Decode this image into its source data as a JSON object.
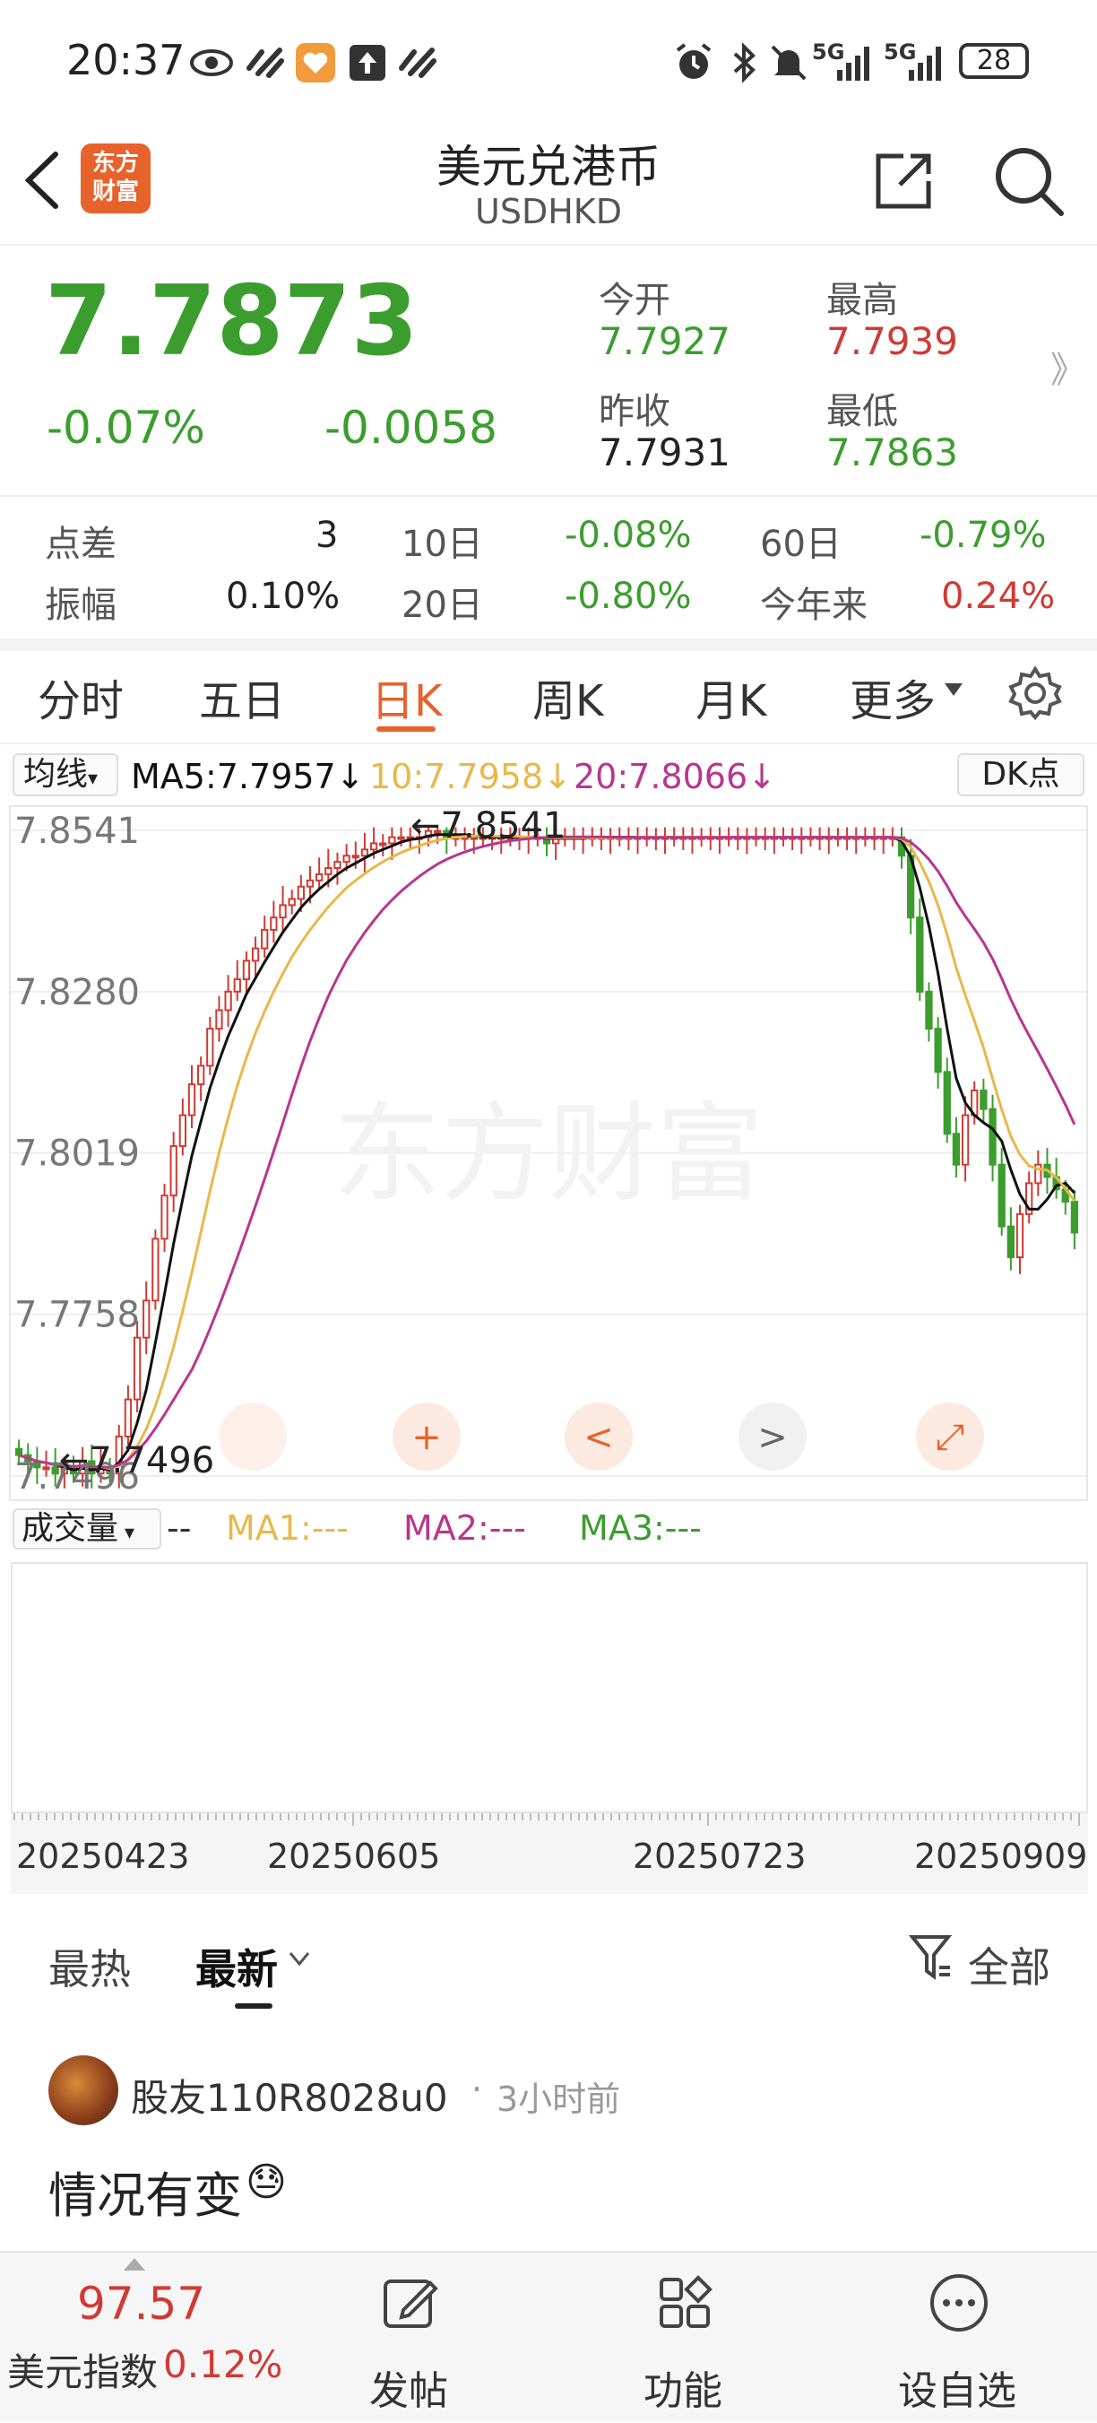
{
  "status_bar": {
    "time": "20:37",
    "battery": "28",
    "net1": "5G",
    "net2": "5G"
  },
  "header": {
    "logo_text": "东方\n财富",
    "title": "美元兑港币",
    "subtitle": "USDHKD"
  },
  "quote": {
    "price": "7.7873",
    "change_pct": "-0.07%",
    "change": "-0.0058",
    "open_label": "今开",
    "open": "7.7927",
    "high_label": "最高",
    "high": "7.7939",
    "prev_close_label": "昨收",
    "prev_close": "7.7931",
    "low_label": "最低",
    "low": "7.7863",
    "more_glyph": "》"
  },
  "stats": {
    "spread_label": "点差",
    "spread": "3",
    "d10_label": "10日",
    "d10": "-0.08%",
    "d60_label": "60日",
    "d60": "-0.79%",
    "amplitude_label": "振幅",
    "amplitude": "0.10%",
    "d20_label": "20日",
    "d20": "-0.80%",
    "ytd_label": "今年来",
    "ytd": "0.24%"
  },
  "tabs": [
    "分时",
    "五日",
    "日K",
    "周K",
    "月K",
    "更多"
  ],
  "active_tab": "日K",
  "ma_bar": {
    "selector": "均线",
    "ma5": "MA5:7.7957",
    "ma10": "10:7.7958",
    "ma20": "20:7.8066",
    "arrow": "↓",
    "dk": "DK点"
  },
  "colors": {
    "up": "#d03a34",
    "down": "#3c9d2f",
    "ma5": "#111111",
    "ma10": "#e8b84a",
    "ma20": "#b8368e",
    "accent": "#e8622b"
  },
  "chart_data": {
    "type": "candlestick",
    "y_ticks": [
      "7.8541",
      "7.8280",
      "7.8019",
      "7.7758",
      "7.7496"
    ],
    "ylim": [
      7.7496,
      7.8541
    ],
    "max_marker": "←7.8541",
    "min_marker": "←7.7496",
    "x_ticks": [
      "20250423",
      "20250605",
      "20250723",
      "20250909"
    ],
    "watermark": "东方财富",
    "grid": true,
    "closes": [
      7.753,
      7.752,
      7.751,
      7.751,
      7.75,
      7.751,
      7.75,
      7.752,
      7.75,
      7.751,
      7.75,
      7.756,
      7.762,
      7.772,
      7.778,
      7.788,
      7.795,
      7.803,
      7.808,
      7.813,
      7.816,
      7.822,
      7.825,
      7.828,
      7.83,
      7.833,
      7.835,
      7.838,
      7.84,
      7.842,
      7.843,
      7.845,
      7.846,
      7.847,
      7.848,
      7.849,
      7.85,
      7.85,
      7.851,
      7.852,
      7.852,
      7.853,
      7.853,
      7.853,
      7.853,
      7.854,
      7.854,
      7.853,
      7.853,
      7.853,
      7.853,
      7.853,
      7.853,
      7.853,
      7.853,
      7.853,
      7.853,
      7.853,
      7.852,
      7.853,
      7.853,
      7.853,
      7.853,
      7.853,
      7.853,
      7.853,
      7.853,
      7.853,
      7.853,
      7.853,
      7.853,
      7.853,
      7.853,
      7.853,
      7.853,
      7.853,
      7.853,
      7.853,
      7.853,
      7.853,
      7.853,
      7.853,
      7.853,
      7.853,
      7.853,
      7.853,
      7.853,
      7.853,
      7.853,
      7.853,
      7.853,
      7.853,
      7.853,
      7.853,
      7.853,
      7.853,
      7.853,
      7.85,
      7.84,
      7.828,
      7.822,
      7.815,
      7.805,
      7.8,
      7.808,
      7.812,
      7.809,
      7.8,
      7.79,
      7.785,
      7.792,
      7.797,
      7.8,
      7.798,
      7.796,
      7.794,
      7.789
    ],
    "ma5_current": 7.7957,
    "ma10_current": 7.7958,
    "ma20_current": 7.8066
  },
  "chart_controls": [
    "+",
    "<",
    ">",
    "⤢"
  ],
  "volume_bar": {
    "selector": "成交量",
    "dash": "--",
    "ma1": "MA1:---",
    "ma2": "MA2:---",
    "ma3": "MA3:---"
  },
  "comments": {
    "tabs": [
      "最热",
      "最新"
    ],
    "active": "最新",
    "filter_label": "全部",
    "post": {
      "user": "股友110R8028u0",
      "time": "3小时前",
      "content": "情况有变",
      "emoji": "😓"
    }
  },
  "bottom_bar": {
    "index_value": "97.57",
    "index_label": "美元指数",
    "index_change": "0.12%",
    "items": [
      "发帖",
      "功能",
      "设自选"
    ]
  }
}
